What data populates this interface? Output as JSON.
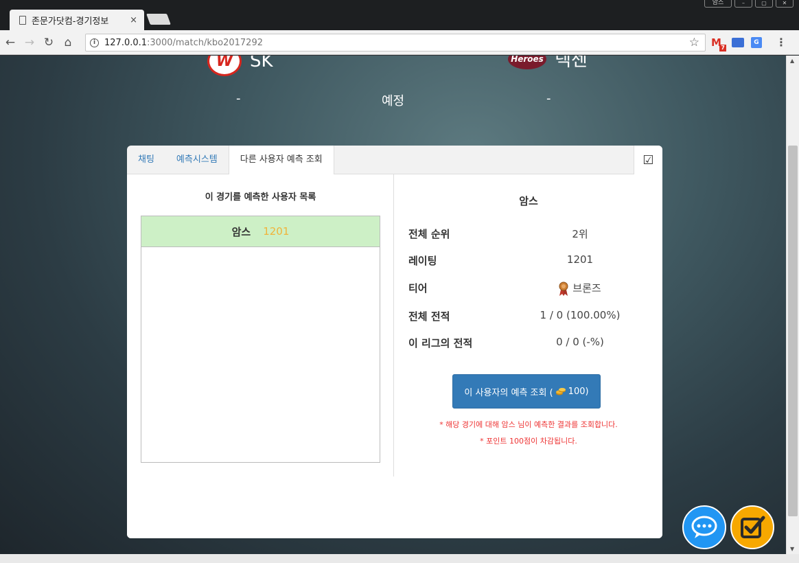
{
  "browser": {
    "tab_title": "존문가닷컴-경기정보",
    "tab_close": "×",
    "url_host": "127.0.0.1",
    "url_path": ":3000/match/kbo2017292",
    "gmail_badge": "7",
    "window_label": "암스"
  },
  "match": {
    "home_team": "SK",
    "home_logo_text": "W",
    "away_team": "넥센",
    "away_logo_text": "Heroes",
    "home_score": "-",
    "away_score": "-",
    "status": "예정"
  },
  "tabs": [
    {
      "label": "채팅"
    },
    {
      "label": "예측시스템"
    },
    {
      "label": "다른 사용자 예측 조회"
    }
  ],
  "predictors": {
    "title": "이 경기를 예측한 사용자 목록",
    "users": [
      {
        "name": "암스",
        "rating": "1201"
      }
    ]
  },
  "profile": {
    "name": "암스",
    "stats": [
      {
        "label": "전체 순위",
        "value": "2위"
      },
      {
        "label": "레이팅",
        "value": "1201"
      },
      {
        "label": "티어",
        "value": "브론즈",
        "icon": "bronze-medal-icon"
      },
      {
        "label": "전체 전적",
        "value": "1 / 0 (100.00%)"
      },
      {
        "label": "이 리그의 전적",
        "value": "0 / 0 (-%)"
      }
    ],
    "lookup_button": {
      "prefix": "이 사용자의 예측 조회 (",
      "cost": "100)"
    },
    "notice_1": "* 해당 경기에 대해 암스 님이 예측한 결과를 조회합니다.",
    "notice_2": "* 포인트 100점이 차감됩니다."
  },
  "colors": {
    "accent": "#337ab7",
    "selected_row": "#cdf0c6",
    "rating_color": "#f0b33a",
    "notice_color": "#e33333",
    "chat_fab": "#2196f3",
    "check_fab": "#f7a800"
  }
}
